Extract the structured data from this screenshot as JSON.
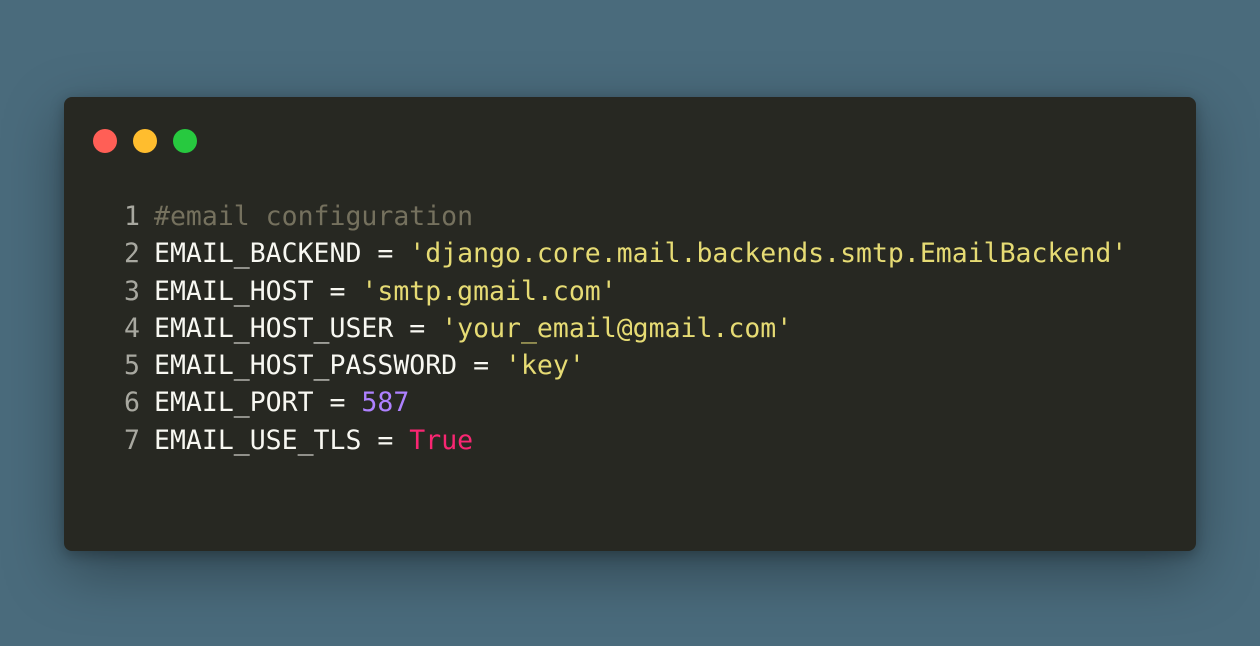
{
  "window": {
    "controls": [
      {
        "name": "close",
        "color": "#ff5f56"
      },
      {
        "name": "minimize",
        "color": "#ffbd2e"
      },
      {
        "name": "maximize",
        "color": "#27c93f"
      }
    ]
  },
  "code": {
    "lines": [
      {
        "number": "1",
        "comment": "#email configuration"
      },
      {
        "number": "2",
        "ident": "EMAIL_BACKEND",
        "op": " = ",
        "value": "'django.core.mail.backends.smtp.EmailBackend'",
        "value_type": "string"
      },
      {
        "number": "3",
        "ident": "EMAIL_HOST",
        "op": " = ",
        "value": "'smtp.gmail.com'",
        "value_type": "string"
      },
      {
        "number": "4",
        "ident": "EMAIL_HOST_USER",
        "op": " = ",
        "value": "'your_email@gmail.com'",
        "value_type": "string"
      },
      {
        "number": "5",
        "ident": "EMAIL_HOST_PASSWORD",
        "op": " = ",
        "value": "'key'",
        "value_type": "string"
      },
      {
        "number": "6",
        "ident": "EMAIL_PORT",
        "op": " = ",
        "value": "587",
        "value_type": "number"
      },
      {
        "number": "7",
        "ident": "EMAIL_USE_TLS",
        "op": " = ",
        "value": "True",
        "value_type": "keyword"
      }
    ]
  },
  "theme": {
    "background": "#4a6b7c",
    "editor_bg": "#272822",
    "comment": "#75715e",
    "string": "#e6db74",
    "number": "#ae81ff",
    "keyword": "#f92672",
    "text": "#f8f8f2"
  }
}
